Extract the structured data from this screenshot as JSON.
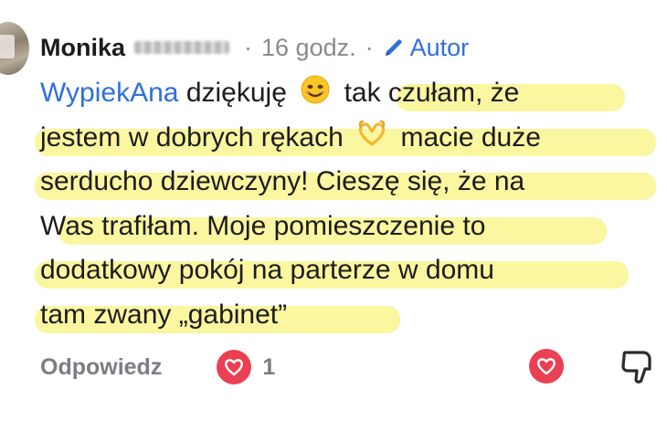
{
  "comment": {
    "author_first_name": "Monika",
    "time_ago": "16 godz.",
    "separator": "·",
    "author_badge": "Autor",
    "mention": "WypiekAna",
    "lines": [
      {
        "a": "dziękuję",
        "b": "tak czułam, że"
      },
      {
        "a": "jestem w dobrych rękach",
        "b": "macie duże"
      },
      {
        "a": "serducho dziewczyny! Cieszę się, że na"
      },
      {
        "a": "Was trafiłam. Moje pomieszczenie to"
      },
      {
        "a": "dodatkowy pokój na parterze w domu"
      },
      {
        "a": "tam zwany „gabinet”"
      }
    ],
    "emojis": [
      "smiling-face-emoji",
      "heart-hands-emoji"
    ]
  },
  "actions": {
    "reply_label": "Odpowiedz",
    "like_count": "1"
  },
  "colors": {
    "mention_blue": "#2f6fdd",
    "highlight_yellow": "#fbf6a0",
    "heart_red": "#e94153",
    "muted_gray": "#7d7d82"
  }
}
